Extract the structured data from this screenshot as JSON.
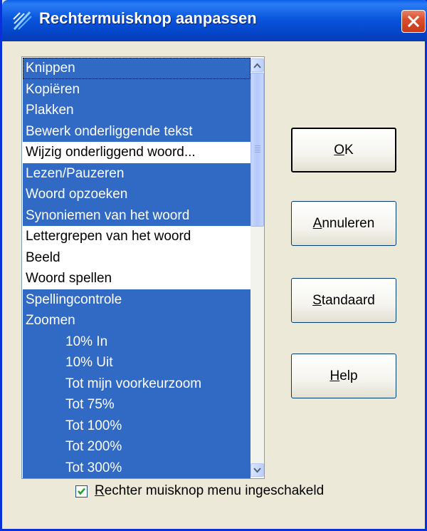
{
  "window": {
    "title": "Rechtermuisknop aanpassen"
  },
  "list": {
    "items": [
      {
        "label": "Knippen",
        "selected": true
      },
      {
        "label": "Kopiëren",
        "selected": true
      },
      {
        "label": "Plakken",
        "selected": true
      },
      {
        "label": "Bewerk onderliggende tekst",
        "selected": true
      },
      {
        "label": "Wijzig onderliggend woord...",
        "selected": false
      },
      {
        "label": "Lezen/Pauzeren",
        "selected": true
      },
      {
        "label": "Woord opzoeken",
        "selected": true
      },
      {
        "label": "Synoniemen van het woord",
        "selected": true
      },
      {
        "label": "Lettergrepen van het woord",
        "selected": false
      },
      {
        "label": "Beeld",
        "selected": false
      },
      {
        "label": "Woord spellen",
        "selected": false
      },
      {
        "label": "Spellingcontrole",
        "selected": true
      },
      {
        "label": "Zoomen",
        "selected": true
      },
      {
        "label": "10% In",
        "selected": true
      },
      {
        "label": "10% Uit",
        "selected": true
      },
      {
        "label": "Tot mijn voorkeurzoom",
        "selected": true
      },
      {
        "label": "Tot 75%",
        "selected": true
      },
      {
        "label": "Tot 100%",
        "selected": true
      },
      {
        "label": "Tot 200%",
        "selected": true
      },
      {
        "label": "Tot 300%",
        "selected": true
      }
    ]
  },
  "buttons": {
    "ok": {
      "mnemonic": "O",
      "rest": "K"
    },
    "cancel": {
      "mnemonic": "A",
      "rest": "nnuleren"
    },
    "default": {
      "mnemonic": "S",
      "rest": "tandaard"
    },
    "help": {
      "mnemonic": "H",
      "rest": "elp"
    }
  },
  "checkbox": {
    "checked": true,
    "mnemonic": "R",
    "rest": "echter muisknop menu ingeschakeld"
  },
  "colors": {
    "selection": "#316AC5",
    "titlebar": "#0A56DD",
    "dialog": "#ECE9D8"
  },
  "icons": [
    "app-icon",
    "close-icon",
    "scroll-up-icon",
    "scroll-down-icon",
    "checkmark-icon"
  ]
}
